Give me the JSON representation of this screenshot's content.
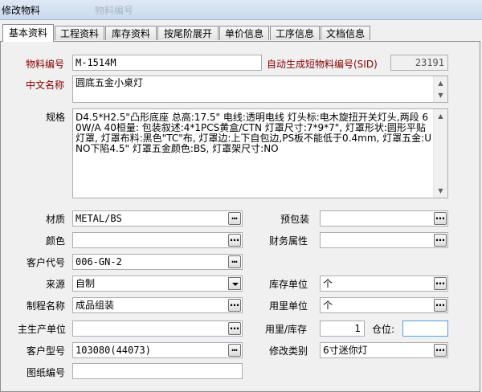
{
  "window": {
    "title": "修改物料",
    "title_overlap": "物料编号"
  },
  "tabs": [
    "基本资料",
    "工程资料",
    "库存资料",
    "按尾阶展开",
    "单价信息",
    "工序信息",
    "文档信息"
  ],
  "form": {
    "material_no_label": "物料编号",
    "material_no": "M-1514M",
    "auto_sid_label": "自动生成短物料编号(SID)",
    "sid_value": "23191",
    "cn_name_label": "中文名称",
    "cn_name": "圆底五金小桌灯",
    "spec_label": "规格",
    "spec_text": "D4.5*H2.5\"凸形底座 总高:17.5\" 电线:透明电线 灯头标:电木旋扭开关灯头,两段 60W/A 40桓量: 包装叙述:4*1PCS黄盒/CTN 灯罩尺寸:7*9*7\", 灯罩形状:圆形平贴灯罩, 灯罩布料:黑色\"TC\"布, 灯罩边:上下自包边,PS板不能低于0.4mm, 灯罩五金:UNO下陷4.5\" 灯罩五金颜色:BS, 灯罩架尺寸:NO",
    "material_label": "材质",
    "material": "METAL/BS",
    "prepack_label": "预包装",
    "prepack": "",
    "color_label": "颜色",
    "color": "",
    "finance_label": "财务属性",
    "finance": "",
    "customer_code_label": "客户代号",
    "customer_code": "006-GN-2",
    "source_label": "来源",
    "source": "自制",
    "stock_unit_label": "库存单位",
    "stock_unit": "个",
    "process_label": "制程名称",
    "process": "成品组装",
    "usage_unit_label": "用里单位",
    "usage_unit": "个",
    "main_unit_label": "主生产单位",
    "main_unit": "",
    "ratio_label": "用里/库存",
    "ratio": "1",
    "position_label": "仓位:",
    "position": "",
    "customer_model_label": "客户型号",
    "customer_model": "103080(44073)",
    "change_type_label": "修改类别",
    "change_type": "6寸迷你灯",
    "drawing_no_label": "图纸编号",
    "drawing_no": ""
  },
  "icons": {
    "browse": "ellipsis-icon",
    "dropdown": "chevron-down-icon",
    "scroll_up": "scroll-up-icon",
    "scroll_down": "scroll-down-icon"
  }
}
